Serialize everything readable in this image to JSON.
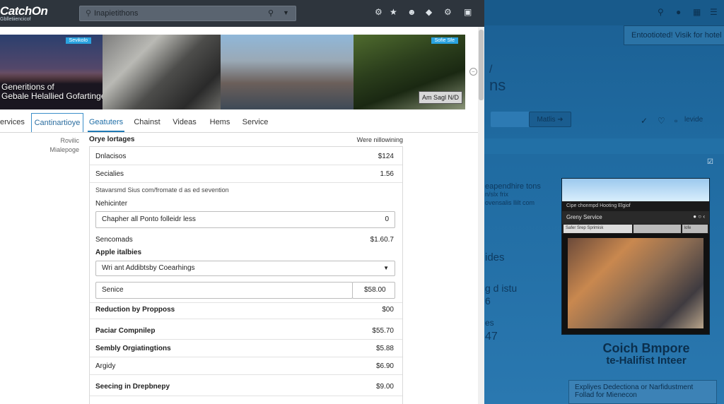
{
  "app": {
    "brand": "CatchOn",
    "tagline": "Gblletiiencicof"
  },
  "search": {
    "placeholder": "Inapietithons"
  },
  "hero": {
    "tag_left": "Sevikolo",
    "tag_right": "Sofie Sfe",
    "title_line1": "Generitions of",
    "title_line2": "Gebale Helallied Gofartinges",
    "badge": "Am Sagl N/D"
  },
  "tabs": [
    "ervices",
    "Cantinartioye",
    "Geatuters",
    "Chainst",
    "Videas",
    "Hems",
    "Service"
  ],
  "sidebar": [
    "Rovilic",
    "Mialepoge"
  ],
  "content": {
    "header_left": "Orye lortages",
    "header_right": "Were nillowining",
    "rows": [
      {
        "label": "Dnlacisos",
        "value": "$124"
      },
      {
        "label": "Secialies",
        "value": "1.56"
      }
    ],
    "note": "Stavarsmd Sius com/fromate d as ed sevention",
    "nehicinter_label": "Nehicinter",
    "nehicinter_field": "Chapher all Ponto folleidr less",
    "nehicinter_value": "0",
    "sencomads_label": "Sencomads",
    "sencomads_value": "$1.60.7",
    "apple_label": "Apple italbies",
    "select_value": "Wri ant Addibtsby Coearhings",
    "service_field": "Senice",
    "service_amount": "$58.00",
    "lines": [
      {
        "label": "Reduction by Propposs",
        "value": "$00"
      },
      {
        "label": "Paciar Compnilep",
        "value": "$55.70"
      },
      {
        "label": "Sembly Orgiatingtions",
        "value": "$5.88"
      },
      {
        "label": "Argidy",
        "value": "$6.90"
      },
      {
        "label": "Seecing in Drepbnepy",
        "value": "$9.00"
      }
    ]
  },
  "background": {
    "tagline": "Entootioted! Visik for hotel",
    "hero_frag1": "/",
    "hero_frag2": "ns",
    "btn1": "",
    "btn2": "Matlis ➜",
    "right_label": "levide",
    "left_frag1": "eapendhire tons",
    "left_frag2": "n/slx frix",
    "left_frag3": "ovensalis llilt com",
    "left_frag4": "ides",
    "left_frag5": "g d istu",
    "left_frag6": "6",
    "left_frag7": "es",
    "left_frag8": "47",
    "card_bar": "Cipe chonmpd Hooting Elgiof",
    "card_title": "Greny Service",
    "card_input": "Safer Srep Sprimisk",
    "card_btn1": "",
    "card_btn2": "lofe",
    "bottom_title": "Coich Bmpore",
    "bottom_sub": "te-Halifist Inteer",
    "bottom_box": "Expliyes Dedectiona or Narfidustment Follad for Mienecon"
  }
}
